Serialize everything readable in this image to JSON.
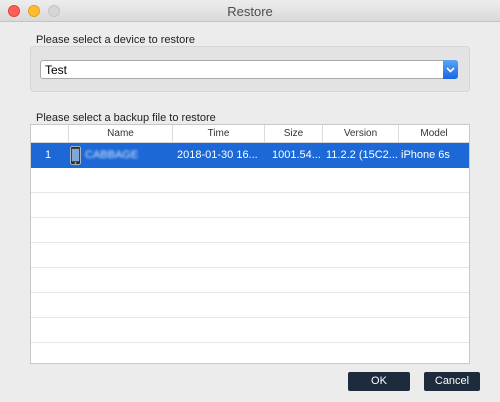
{
  "window": {
    "title": "Restore"
  },
  "device_section": {
    "label": "Please select a device to restore",
    "selected_device": "Test"
  },
  "backup_section": {
    "label": "Please select a backup file to restore",
    "columns": [
      "Name",
      "Time",
      "Size",
      "Version",
      "Model"
    ],
    "rows": [
      {
        "index": "1",
        "icon": "phone-icon",
        "name": "CABBAGE",
        "time": "2018-01-30 16...",
        "size": "1001.54...",
        "version": "11.2.2 (15C2...",
        "model": "iPhone 6s"
      }
    ]
  },
  "buttons": {
    "ok": "OK",
    "cancel": "Cancel"
  },
  "colors": {
    "selection": "#1b68d6",
    "button": "#1d2b3c",
    "select_accent": "#1967e4"
  }
}
